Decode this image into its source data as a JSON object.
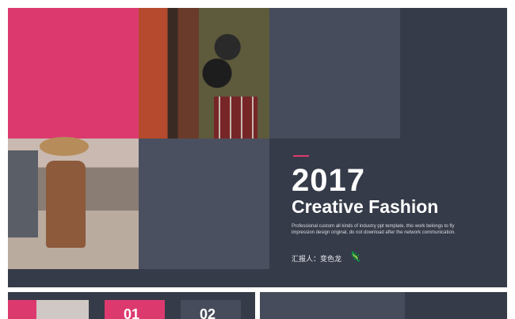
{
  "slide": {
    "year": "2017",
    "title": "Creative Fashion",
    "description": "Professional custom all kinds of industry ppt template, this work belongs to fly impression design original, do not download after the network communication.",
    "reporter_label": "汇报人：变色龙"
  },
  "next_slides": {
    "badge_1": "01",
    "badge_2": "02"
  },
  "colors": {
    "background": "#363b49",
    "accent": "#dc3a6f",
    "slate": "#464c5c"
  }
}
